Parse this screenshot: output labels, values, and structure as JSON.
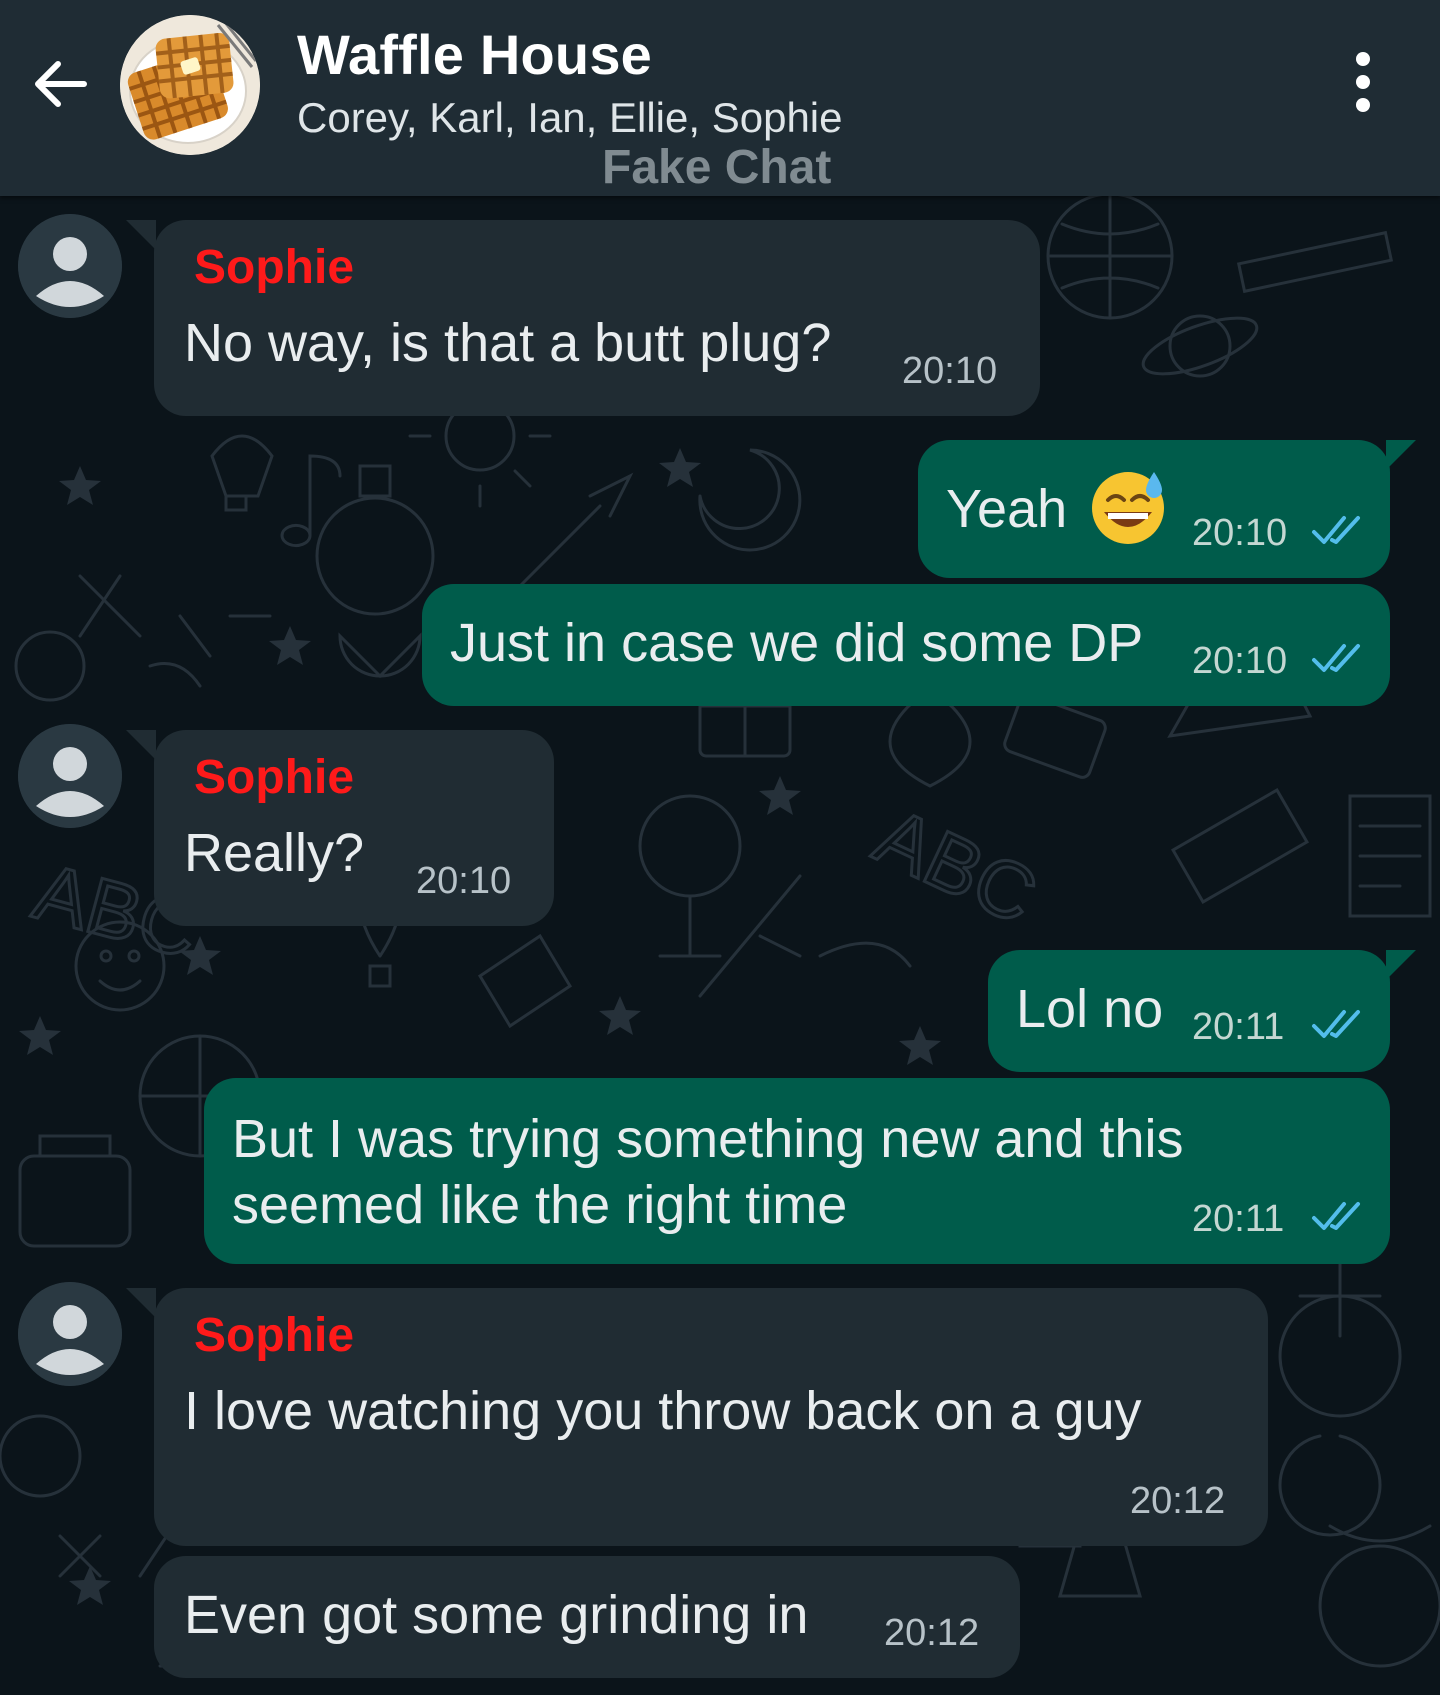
{
  "header": {
    "title": "Waffle House",
    "members": "Corey, Karl, Ian, Ellie, Sophie",
    "watermark": "Fake Chat"
  },
  "messages": [
    {
      "direction": "in",
      "sender": "Sophie",
      "text": "No way, is that a butt plug?",
      "time": "20:10"
    },
    {
      "direction": "out",
      "text": "Yeah",
      "emoji": "sweat-smile-emoji",
      "time": "20:10",
      "status": "read"
    },
    {
      "direction": "out",
      "text": "Just in case we did some DP",
      "time": "20:10",
      "status": "read"
    },
    {
      "direction": "in",
      "sender": "Sophie",
      "text": "Really?",
      "time": "20:10"
    },
    {
      "direction": "out",
      "text": "Lol no",
      "time": "20:11",
      "status": "read"
    },
    {
      "direction": "out",
      "text_lines": [
        "But I was trying something new and this",
        "seemed like the right time"
      ],
      "time": "20:11",
      "status": "read"
    },
    {
      "direction": "in",
      "sender": "Sophie",
      "text": "I love watching you throw back on a guy",
      "time": "20:12"
    },
    {
      "direction": "in",
      "text": "Even got some grinding in",
      "time": "20:12"
    }
  ],
  "colors": {
    "header_bg": "#1f2c34",
    "chat_bg": "#0b141a",
    "incoming_bubble": "#202c33",
    "outgoing_bubble": "#005c4b",
    "sender_name": "#ff1a1a",
    "read_ticks": "#53bdeb"
  }
}
